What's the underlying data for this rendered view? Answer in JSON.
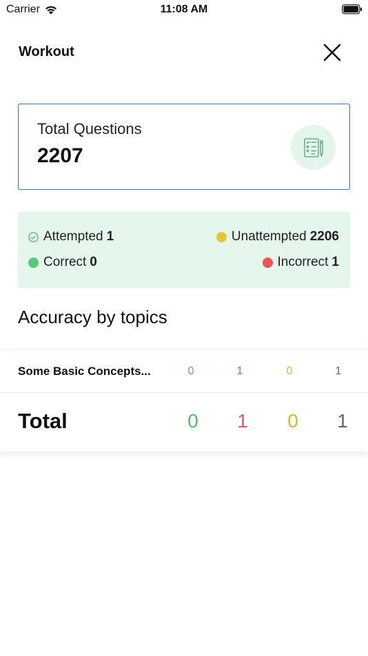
{
  "status_bar": {
    "carrier": "Carrier",
    "time": "11:08 AM"
  },
  "header": {
    "title": "Workout"
  },
  "total_card": {
    "label": "Total Questions",
    "value": "2207",
    "icon": "checklist-icon"
  },
  "stats": {
    "attempted_label": "Attempted",
    "attempted_value": "1",
    "unattempted_label": "Unattempted",
    "unattempted_value": "2206",
    "correct_label": "Correct",
    "correct_value": "0",
    "incorrect_label": "Incorrect",
    "incorrect_value": "1"
  },
  "accuracy": {
    "title": "Accuracy by topics",
    "rows": [
      {
        "topic": "Some Basic Concepts...",
        "correct": "0",
        "incorrect": "1",
        "unattempted": "0",
        "attempted": "1"
      }
    ],
    "total": {
      "label": "Total",
      "correct": "0",
      "incorrect": "1",
      "unattempted": "0",
      "attempted": "1"
    }
  },
  "colors": {
    "correct": "#52b86a",
    "incorrect": "#e0566a",
    "unattempted": "#d9b62a",
    "attempted": "#666666",
    "card_border": "#3f6fb0",
    "stats_bg": "#e5f6ec"
  }
}
